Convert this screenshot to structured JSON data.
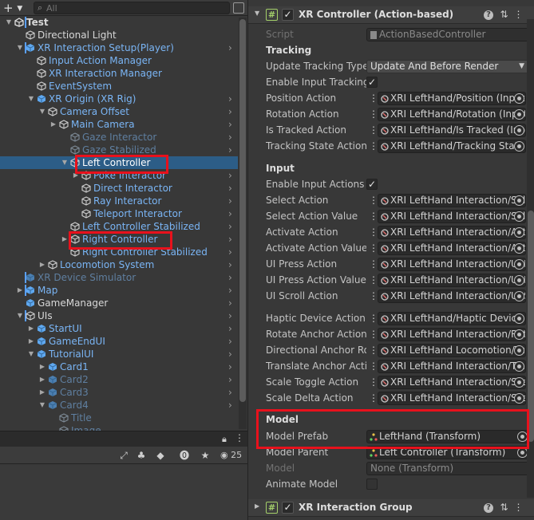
{
  "hierarchy": {
    "add_label": "+",
    "search_placeholder": "All",
    "rows": [
      {
        "label": "Test",
        "fold": "down",
        "icon": "unity-scene-icon",
        "color": "white",
        "bold": true
      },
      {
        "label": "Directional Light",
        "fold": "",
        "icon": "cube-icon",
        "color": "white"
      },
      {
        "label": "XR Interaction Setup(Player)",
        "fold": "down",
        "icon": "prefab-cube-icon",
        "color": "blue"
      },
      {
        "label": "Input Action Manager",
        "fold": "",
        "icon": "cube-icon",
        "color": "blue"
      },
      {
        "label": "XR Interaction Manager",
        "fold": "",
        "icon": "cube-icon",
        "color": "blue"
      },
      {
        "label": "EventSystem",
        "fold": "",
        "icon": "cube-icon",
        "color": "blue"
      },
      {
        "label": "XR Origin (XR Rig)",
        "fold": "down",
        "icon": "prefab-cube-icon",
        "color": "blue"
      },
      {
        "label": "Camera Offset",
        "fold": "down",
        "icon": "cube-icon",
        "color": "blue"
      },
      {
        "label": "Main Camera",
        "fold": "right",
        "icon": "cube-icon",
        "color": "blue"
      },
      {
        "label": "Gaze Interactor",
        "fold": "",
        "icon": "cube-icon",
        "color": "dim"
      },
      {
        "label": "Gaze Stabilized",
        "fold": "",
        "icon": "cube-icon",
        "color": "dim"
      },
      {
        "label": "Left Controller",
        "fold": "down",
        "icon": "cube-icon",
        "color": "white"
      },
      {
        "label": "Poke Interactor",
        "fold": "right",
        "icon": "cube-icon",
        "color": "blue"
      },
      {
        "label": "Direct Interactor",
        "fold": "",
        "icon": "cube-icon",
        "color": "blue"
      },
      {
        "label": "Ray Interactor",
        "fold": "",
        "icon": "cube-icon",
        "color": "blue"
      },
      {
        "label": "Teleport Interactor",
        "fold": "",
        "icon": "cube-icon",
        "color": "blue"
      },
      {
        "label": "Left Controller Stabilized",
        "fold": "",
        "icon": "cube-icon",
        "color": "blue"
      },
      {
        "label": "Right Controller",
        "fold": "right",
        "icon": "cube-icon",
        "color": "blue"
      },
      {
        "label": "Right Controller Stabilized",
        "fold": "",
        "icon": "cube-icon",
        "color": "blue"
      },
      {
        "label": "Locomotion System",
        "fold": "right",
        "icon": "cube-icon",
        "color": "blue"
      },
      {
        "label": "XR Device Simulator",
        "fold": "",
        "icon": "prefab-cube-icon",
        "color": "dim"
      },
      {
        "label": "Map",
        "fold": "right",
        "icon": "prefab-cube-icon",
        "color": "blue"
      },
      {
        "label": "GameManager",
        "fold": "",
        "icon": "prefab-cube-icon",
        "color": "white"
      },
      {
        "label": "UIs",
        "fold": "down",
        "icon": "cube-icon",
        "color": "white"
      },
      {
        "label": "StartUI",
        "fold": "right",
        "icon": "prefab-cube-icon",
        "color": "blue"
      },
      {
        "label": "GameEndUI",
        "fold": "right",
        "icon": "prefab-cube-icon",
        "color": "blue"
      },
      {
        "label": "TutorialUI",
        "fold": "down",
        "icon": "prefab-cube-icon",
        "color": "blue"
      },
      {
        "label": "Card1",
        "fold": "right",
        "icon": "prefab-cube-icon",
        "color": "blue"
      },
      {
        "label": "Card2",
        "fold": "right",
        "icon": "prefab-cube-icon",
        "color": "dim"
      },
      {
        "label": "Card3",
        "fold": "right",
        "icon": "prefab-cube-icon",
        "color": "dim"
      },
      {
        "label": "Card4",
        "fold": "down",
        "icon": "prefab-cube-icon",
        "color": "dim"
      },
      {
        "label": "Title",
        "fold": "",
        "icon": "cube-icon",
        "color": "dim"
      },
      {
        "label": "Image",
        "fold": "",
        "icon": "cube-icon",
        "color": "dim"
      }
    ]
  },
  "console": {
    "count": "25"
  },
  "inspector": {
    "component_title": "XR Controller (Action-based)",
    "script_label": "Script",
    "script_value": "ActionBasedController",
    "tracking_header": "Tracking",
    "update_tracking_label": "Update Tracking Type",
    "update_tracking_value": "Update And Before Render",
    "enable_input_tracking_label": "Enable Input Tracking",
    "tracking_actions": [
      {
        "label": "Position Action",
        "value": "XRI LeftHand/Position (Input Action Reference)"
      },
      {
        "label": "Rotation Action",
        "value": "XRI LeftHand/Rotation (Input Action Reference)"
      },
      {
        "label": "Is Tracked Action",
        "value": "XRI LeftHand/Is Tracked (Input Action Reference)"
      },
      {
        "label": "Tracking State Action",
        "value": "XRI LeftHand/Tracking State (Input Action Reference)"
      }
    ],
    "input_header": "Input",
    "enable_input_actions_label": "Enable Input Actions",
    "input_actions": [
      {
        "label": "Select Action",
        "value": "XRI LeftHand Interaction/Select"
      },
      {
        "label": "Select Action Value",
        "value": "XRI LeftHand Interaction/Select Value"
      },
      {
        "label": "Activate Action",
        "value": "XRI LeftHand Interaction/Activate"
      },
      {
        "label": "Activate Action Value",
        "value": "XRI LeftHand Interaction/Activate Value"
      },
      {
        "label": "UI Press Action",
        "value": "XRI LeftHand Interaction/UI Press"
      },
      {
        "label": "UI Press Action Value",
        "value": "XRI LeftHand Interaction/UI Press Value"
      },
      {
        "label": "UI Scroll Action",
        "value": "XRI LeftHand Interaction/UI Scroll"
      }
    ],
    "other_actions": [
      {
        "label": "Haptic Device Action",
        "value": "XRI LeftHand/Haptic Device"
      },
      {
        "label": "Rotate Anchor Action",
        "value": "XRI LeftHand Interaction/Rotate Anchor"
      },
      {
        "label": "Directional Anchor Rotation",
        "value": "XRI LeftHand Locomotion/Turn"
      },
      {
        "label": "Translate Anchor Action",
        "value": "XRI LeftHand Interaction/Translate Anchor"
      },
      {
        "label": "Scale Toggle Action",
        "value": "XRI LeftHand Interaction/Scale Toggle"
      },
      {
        "label": "Scale Delta Action",
        "value": "XRI LeftHand Interaction/Scale Delta"
      }
    ],
    "model_header": "Model",
    "model_prefab_label": "Model Prefab",
    "model_prefab_value": "LeftHand (Transform)",
    "model_parent_label": "Model Parent",
    "model_parent_value": "Left Controller (Transform)",
    "model_label": "Model",
    "model_value": "None (Transform)",
    "animate_model_label": "Animate Model",
    "next_component_title": "XR Interaction Group"
  },
  "colors": {
    "highlight": "#e8111c",
    "selection": "#2c5d87",
    "prefab_blue": "#7ab5f5"
  }
}
